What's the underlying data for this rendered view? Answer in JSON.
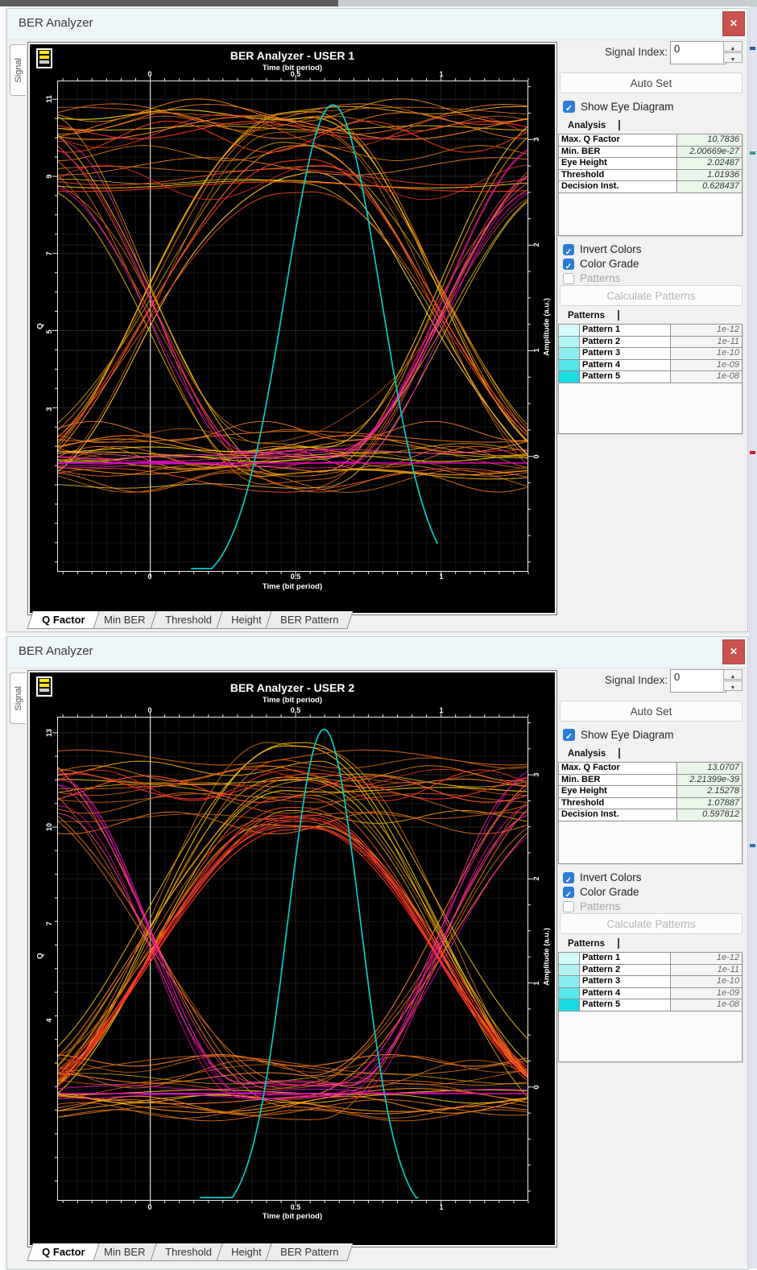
{
  "icons": {
    "close": "✕",
    "check": "✓",
    "up": "▲",
    "down": "▼"
  },
  "windows": [
    {
      "title": "BER Analyzer",
      "side_tab": "Signal",
      "right_panel": {
        "signal_index_label": "Signal Index:",
        "signal_index_value": "0",
        "auto_set": "Auto Set",
        "show_eye_diagram": "Show Eye Diagram",
        "analysis_tab": "Analysis",
        "analysis_rows": [
          {
            "label": "Max. Q Factor",
            "value": "10.7836"
          },
          {
            "label": "Min. BER",
            "value": "2.00669e-27"
          },
          {
            "label": "Eye Height",
            "value": "2.02487"
          },
          {
            "label": "Threshold",
            "value": "1.01936"
          },
          {
            "label": "Decision Inst.",
            "value": "0.628437"
          }
        ],
        "invert_colors": "Invert Colors",
        "color_grade": "Color Grade",
        "patterns_checkbox": "Patterns",
        "calculate_patterns": "Calculate Patterns",
        "patterns_tab": "Patterns",
        "patterns_rows": [
          {
            "label": "Pattern 1",
            "value": "1e-12",
            "color": "#d4fbfb"
          },
          {
            "label": "Pattern 2",
            "value": "1e-11",
            "color": "#b2f4f6"
          },
          {
            "label": "Pattern 3",
            "value": "1e-10",
            "color": "#8aeef0"
          },
          {
            "label": "Pattern 4",
            "value": "1e-09",
            "color": "#55e7ea"
          },
          {
            "label": "Pattern 5",
            "value": "1e-08",
            "color": "#17dde2"
          }
        ]
      },
      "bottom_tabs": [
        "Q Factor",
        "Min BER",
        "Threshold",
        "Height",
        "BER Pattern"
      ]
    },
    {
      "title": "BER Analyzer",
      "side_tab": "Signal",
      "right_panel": {
        "signal_index_label": "Signal Index:",
        "signal_index_value": "0",
        "auto_set": "Auto Set",
        "show_eye_diagram": "Show Eye Diagram",
        "analysis_tab": "Analysis",
        "analysis_rows": [
          {
            "label": "Max. Q Factor",
            "value": "13.0707"
          },
          {
            "label": "Min. BER",
            "value": "2.21399e-39"
          },
          {
            "label": "Eye Height",
            "value": "2.15278"
          },
          {
            "label": "Threshold",
            "value": "1.07887"
          },
          {
            "label": "Decision Inst.",
            "value": "0.597812"
          }
        ],
        "invert_colors": "Invert Colors",
        "color_grade": "Color Grade",
        "patterns_checkbox": "Patterns",
        "calculate_patterns": "Calculate Patterns",
        "patterns_tab": "Patterns",
        "patterns_rows": [
          {
            "label": "Pattern 1",
            "value": "1e-12",
            "color": "#d4fbfb"
          },
          {
            "label": "Pattern 2",
            "value": "1e-11",
            "color": "#b2f4f6"
          },
          {
            "label": "Pattern 3",
            "value": "1e-10",
            "color": "#8aeef0"
          },
          {
            "label": "Pattern 4",
            "value": "1e-09",
            "color": "#55e7ea"
          },
          {
            "label": "Pattern 5",
            "value": "1e-08",
            "color": "#17dde2"
          }
        ]
      },
      "bottom_tabs": [
        "Q Factor",
        "Min BER",
        "Threshold",
        "Height",
        "BER Pattern"
      ]
    }
  ],
  "chart_data": [
    {
      "type": "line",
      "subtype": "eye-diagram",
      "title": "BER Analyzer - USER 1",
      "top_axis_label": "Time (bit period)",
      "xlabel": "Time (bit period)",
      "ylabel_left": "Q",
      "ylabel_right": "Amplitude (a.u.)",
      "xlim": [
        -0.32,
        1.3
      ],
      "xticks": [
        "0",
        "0.5",
        "1"
      ],
      "xtick_values": [
        0,
        0.5,
        1
      ],
      "left_axis": {
        "ticks": [
          "11",
          "9",
          "7",
          "5",
          "3"
        ],
        "tick_fracs": [
          0.038,
          0.195,
          0.353,
          0.511,
          0.669
        ]
      },
      "right_axis": {
        "ticks": [
          "3",
          "2",
          "1",
          "0"
        ],
        "tick_fracs": [
          0.12,
          0.335,
          0.55,
          0.765
        ],
        "amp_lim": [
          -1.09,
          3.56
        ]
      },
      "measurements": {
        "max_q_factor": 10.7836,
        "min_ber": "2.00669e-27",
        "eye_height": 2.02487,
        "threshold": 1.01936,
        "decision_instant": 0.628437
      },
      "series": [
        {
          "name": "q_factor_curve",
          "color": "#00cccc",
          "mu": 0.628,
          "sigma": 0.165,
          "peak_amp": 3.33,
          "base_amp": -1.25,
          "t_range": [
            0.14,
            0.99
          ]
        },
        {
          "name": "zero_level_segment",
          "color": "#6633ff",
          "amp": -0.06,
          "t_range": [
            -0.32,
            0.12
          ]
        },
        {
          "name": "zero_level_line",
          "color": "#ff00cc",
          "amp": -0.06
        }
      ],
      "palette": {
        "yellows": [
          "#ffd90a",
          "#f5c400",
          "#ffcc33",
          "#e6b800",
          "#ffbf00"
        ],
        "oranges": [
          "#ff9100",
          "#f07818",
          "#d96a10",
          "#ff7f24",
          "#c75b12"
        ],
        "reds": [
          "#ff3a1a",
          "#ff2d2d",
          "#f44722",
          "#ff5533",
          "#e03010"
        ],
        "magentas": [
          "#ff00aa",
          "#ff2d9b",
          "#e800c8",
          "#ff4da0"
        ]
      },
      "render": {
        "seed": 11,
        "flat_high": 15,
        "flat_low": 12,
        "transitions": 27,
        "red_arcs": 2,
        "magenta_cluster": 8,
        "high_range": [
          2.55,
          3.38
        ],
        "low_range": [
          -0.32,
          0.28
        ],
        "flat_high_red_ratio": 0.6,
        "transition_width": [
          0.78,
          1.0
        ]
      }
    },
    {
      "type": "line",
      "subtype": "eye-diagram",
      "title": "BER Analyzer - USER 2",
      "top_axis_label": "Time (bit period)",
      "xlabel": "Time (bit period)",
      "ylabel_left": "Q",
      "ylabel_right": "Amplitude (a.u.)",
      "xlim": [
        -0.32,
        1.3
      ],
      "xticks": [
        "0",
        "0.5",
        "1"
      ],
      "xtick_values": [
        0,
        0.5,
        1
      ],
      "left_axis": {
        "ticks": [
          "13",
          "10",
          "7",
          "4"
        ],
        "tick_fracs": [
          0.033,
          0.228,
          0.428,
          0.628
        ]
      },
      "right_axis": {
        "ticks": [
          "3",
          "2",
          "1",
          "0"
        ],
        "tick_fracs": [
          0.12,
          0.335,
          0.55,
          0.765
        ],
        "amp_lim": [
          -1.09,
          3.56
        ]
      },
      "measurements": {
        "max_q_factor": 13.0707,
        "min_ber": "2.21399e-39",
        "eye_height": 2.15278,
        "threshold": 1.07887,
        "decision_instant": 0.597812
      },
      "series": [
        {
          "name": "q_factor_curve",
          "color": "#00cccc",
          "mu": 0.598,
          "sigma": 0.125,
          "peak_amp": 3.44,
          "base_amp": -1.25,
          "t_range": [
            0.17,
            0.93
          ]
        },
        {
          "name": "zero_level_segment",
          "color": "#3b3bff",
          "amp": -0.06,
          "t_range": [
            -0.05,
            0.38
          ]
        },
        {
          "name": "zero_level_line",
          "color": "#ff00cc",
          "amp": -0.06
        }
      ],
      "palette": {
        "yellows": [
          "#ffd90a",
          "#f5c400",
          "#ffcc33",
          "#e6b800",
          "#ffbf00"
        ],
        "oranges": [
          "#ff9100",
          "#f07818",
          "#d96a10",
          "#ff7f24",
          "#c75b12"
        ],
        "reds": [
          "#ff3a1a",
          "#ff2d2d",
          "#f44722",
          "#ff5533",
          "#e03010"
        ],
        "magentas": [
          "#ff00aa",
          "#ff2d9b",
          "#e800c8",
          "#ff4da0"
        ]
      },
      "render": {
        "seed": 29,
        "flat_high": 10,
        "flat_low": 12,
        "transitions": 27,
        "red_arcs": 9,
        "magenta_cluster": 8,
        "high_range": [
          2.45,
          3.3
        ],
        "low_range": [
          -0.32,
          0.28
        ],
        "flat_high_red_ratio": 0.3,
        "transition_width": [
          0.8,
          1.05
        ]
      }
    }
  ]
}
